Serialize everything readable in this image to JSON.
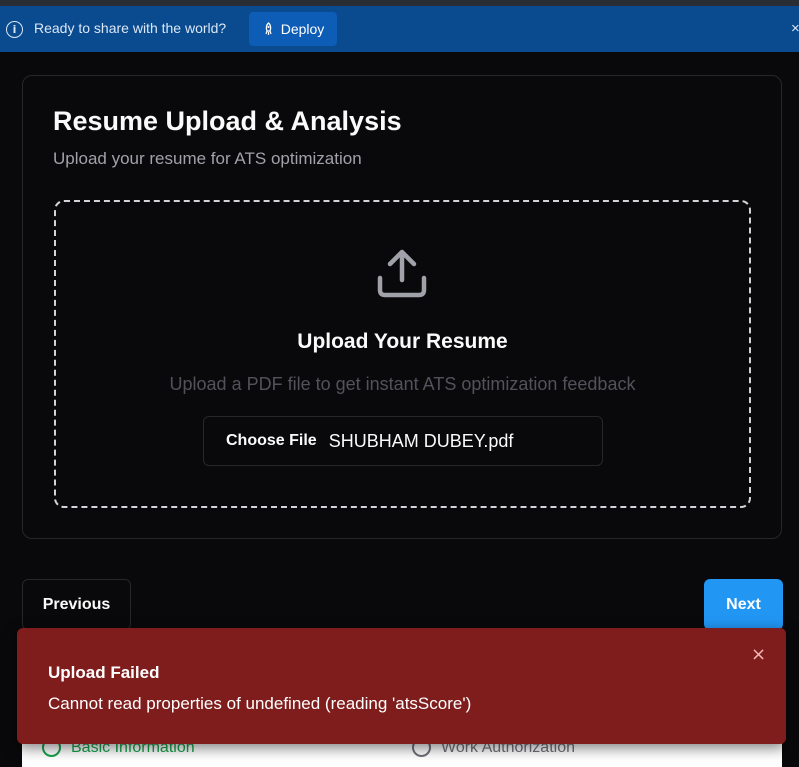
{
  "banner": {
    "message": "Ready to share with the world?",
    "deploy_label": "Deploy",
    "info_icon": "i",
    "close_icon": "×"
  },
  "card": {
    "title": "Resume Upload & Analysis",
    "subtitle": "Upload your resume for ATS optimization",
    "dropzone": {
      "icon": "upload-icon",
      "title": "Upload Your Resume",
      "description": "Upload a PDF file to get instant ATS optimization feedback",
      "choose_file_label": "Choose File",
      "file_name": "SHUBHAM DUBEY.pdf"
    }
  },
  "nav": {
    "previous_label": "Previous",
    "next_label": "Next"
  },
  "steps": [
    {
      "label": "Basic Information",
      "status": "complete"
    },
    {
      "label": "Work Authorization",
      "status": "pending"
    }
  ],
  "toast": {
    "title": "Upload Failed",
    "message": "Cannot read properties of undefined (reading 'atsScore')",
    "close_icon": "×"
  },
  "colors": {
    "banner": "#0a4a8f",
    "background": "#09090b",
    "next_button": "#2196f3",
    "toast": "#7f1d1d",
    "step_complete": "#16a34a"
  }
}
